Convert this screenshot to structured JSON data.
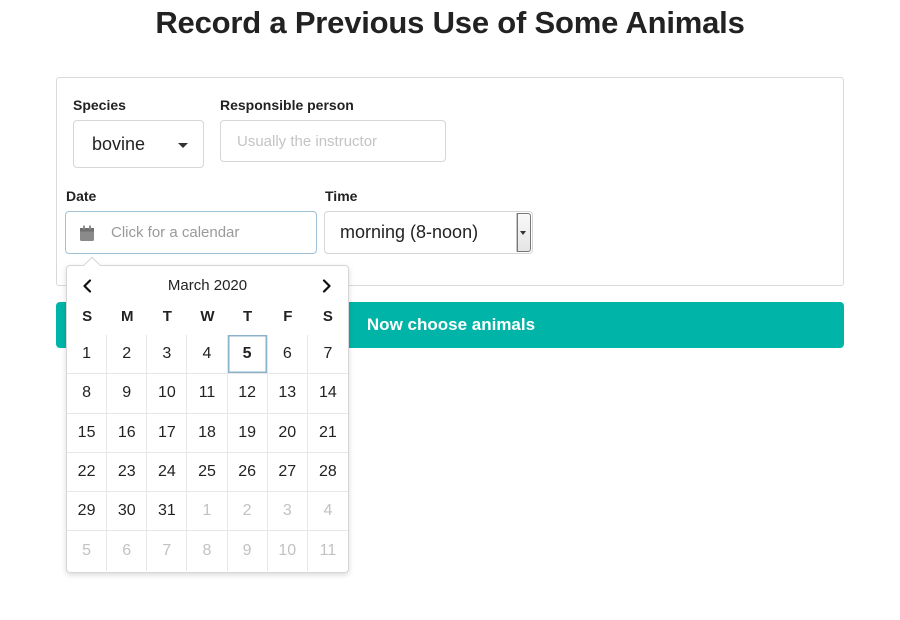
{
  "page": {
    "title": "Record a Previous Use of Some Animals"
  },
  "form": {
    "species_label": "Species",
    "species_value": "bovine",
    "person_label": "Responsible person",
    "person_placeholder": "Usually the instructor",
    "date_label": "Date",
    "date_placeholder": "Click for a calendar",
    "time_label": "Time",
    "time_value": "morning (8-noon)"
  },
  "button": {
    "label": "Now choose animals"
  },
  "calendar": {
    "month_label": "March 2020",
    "weekdays": [
      "S",
      "M",
      "T",
      "W",
      "T",
      "F",
      "S"
    ],
    "days": [
      {
        "label": "1"
      },
      {
        "label": "2"
      },
      {
        "label": "3"
      },
      {
        "label": "4"
      },
      {
        "label": "5",
        "today": true
      },
      {
        "label": "6"
      },
      {
        "label": "7"
      },
      {
        "label": "8"
      },
      {
        "label": "9"
      },
      {
        "label": "10"
      },
      {
        "label": "11"
      },
      {
        "label": "12"
      },
      {
        "label": "13"
      },
      {
        "label": "14"
      },
      {
        "label": "15"
      },
      {
        "label": "16"
      },
      {
        "label": "17"
      },
      {
        "label": "18"
      },
      {
        "label": "19"
      },
      {
        "label": "20"
      },
      {
        "label": "21"
      },
      {
        "label": "22"
      },
      {
        "label": "23"
      },
      {
        "label": "24"
      },
      {
        "label": "25"
      },
      {
        "label": "26"
      },
      {
        "label": "27"
      },
      {
        "label": "28"
      },
      {
        "label": "29"
      },
      {
        "label": "30"
      },
      {
        "label": "31"
      },
      {
        "label": "1",
        "out": true
      },
      {
        "label": "2",
        "out": true
      },
      {
        "label": "3",
        "out": true
      },
      {
        "label": "4",
        "out": true
      },
      {
        "label": "5",
        "out": true
      },
      {
        "label": "6",
        "out": true
      },
      {
        "label": "7",
        "out": true
      },
      {
        "label": "8",
        "out": true
      },
      {
        "label": "9",
        "out": true
      },
      {
        "label": "10",
        "out": true
      },
      {
        "label": "11",
        "out": true
      }
    ]
  },
  "colors": {
    "accent": "#00b4a8",
    "focus_border": "#9fc3d6"
  },
  "icons": [
    "calendar-icon",
    "caret-down-icon",
    "chevron-left-icon",
    "chevron-right-icon"
  ]
}
